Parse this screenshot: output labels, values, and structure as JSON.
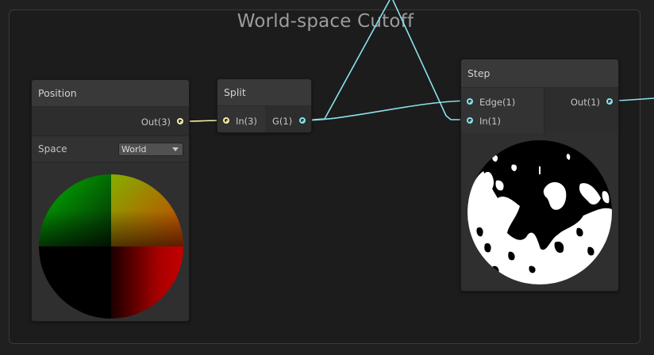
{
  "group": {
    "title": "World-space Cutoff"
  },
  "nodes": {
    "position": {
      "title": "Position",
      "output_port": "Out(3)",
      "space_label": "Space",
      "space_value": "World"
    },
    "split": {
      "title": "Split",
      "input_port": "In(3)",
      "output_port": "G(1)"
    },
    "step": {
      "title": "Step",
      "input_edge": "Edge(1)",
      "input_in": "In(1)",
      "output_port": "Out(1)"
    }
  },
  "colors": {
    "vector3_wire": "#f5f0a8",
    "vector1_wire": "#8ae2ec",
    "node_body": "#393939",
    "canvas_bg": "#202020"
  }
}
